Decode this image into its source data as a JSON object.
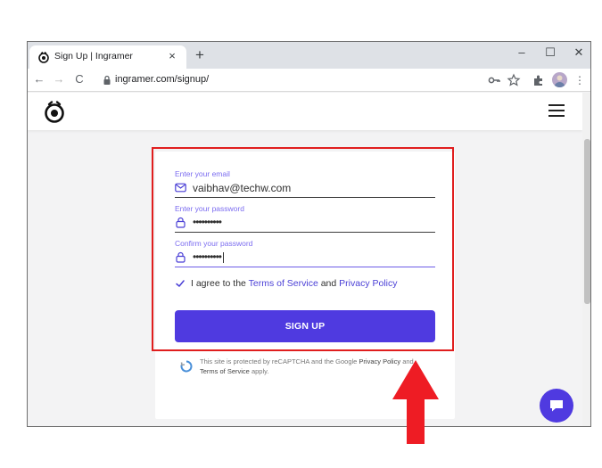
{
  "browser": {
    "tab_title": "Sign Up | Ingramer",
    "tab_close": "×",
    "new_tab": "+",
    "minimize": "–",
    "maximize": "☐",
    "close": "✕",
    "back": "←",
    "forward": "→",
    "reload": "C",
    "url": "ingramer.com/signup/",
    "menu": "⋮"
  },
  "form": {
    "email_label": "Enter your email",
    "email_value": "vaibhav@techw.com",
    "password_label": "Enter your password",
    "password_value": "••••••••••",
    "confirm_label": "Confirm your password",
    "confirm_value": "••••••••••",
    "agree_prefix": "I agree to the ",
    "terms_link": "Terms of Service",
    "agree_and": " and ",
    "privacy_link": "Privacy Policy",
    "signup_button": "SIGN UP"
  },
  "recaptcha": {
    "prefix": "This site is protected by reCAPTCHA and the Google ",
    "privacy": "Privacy Policy",
    "and": " and",
    "terms": "Terms of Service",
    "suffix": " apply."
  },
  "colors": {
    "accent": "#4f3ae0",
    "label": "#7b6cf0",
    "annotation": "#e01e1e"
  },
  "icons": {
    "site_logo": "ingramer-logo-icon",
    "menu": "hamburger-menu-icon",
    "email": "envelope-icon",
    "password": "lock-icon",
    "check": "checkmark-icon",
    "chat": "chat-bubble-icon"
  }
}
